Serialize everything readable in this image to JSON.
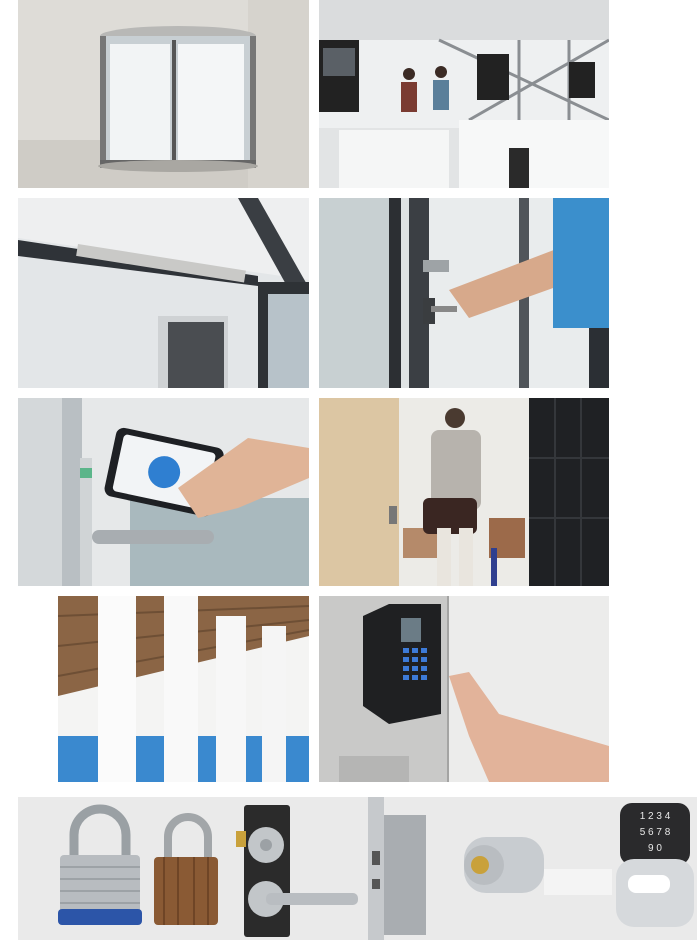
{
  "gallery": {
    "tiles": [
      {
        "id": "revolving-door"
      },
      {
        "id": "security-turnstiles"
      },
      {
        "id": "door-closer"
      },
      {
        "id": "key-in-lock"
      },
      {
        "id": "smartphone-access"
      },
      {
        "id": "hotel-room-entry"
      },
      {
        "id": "sliding-partition-walls"
      },
      {
        "id": "keypad-reader"
      },
      {
        "id": "lock-products"
      }
    ]
  },
  "keypad": {
    "digits": [
      "1",
      "2",
      "3",
      "4",
      "5",
      "6",
      "7",
      "8",
      "9",
      "0"
    ]
  },
  "colors": {
    "padlock_blue": "#2c55a8",
    "wood": "#8a5a34",
    "brass": "#c9a13b",
    "glass_blue": "#3f8fd6"
  }
}
